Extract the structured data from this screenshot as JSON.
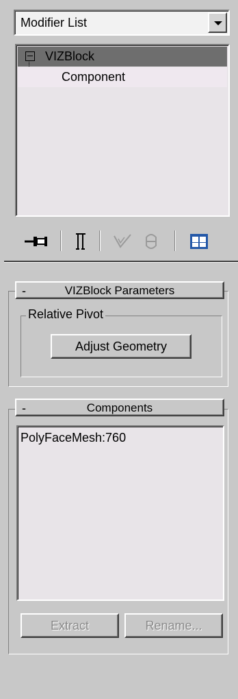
{
  "modifier_dropdown": {
    "value": "Modifier List"
  },
  "stack": {
    "items": [
      {
        "label": "VIZBlock",
        "selected": true,
        "expander": "minus"
      },
      {
        "label": "Component",
        "selected": false
      }
    ]
  },
  "toolbar": {
    "icons": [
      "pin-stack-icon",
      "show-end-result-icon",
      "make-unique-icon",
      "remove-modifier-icon",
      "configure-modifier-sets-icon"
    ]
  },
  "vizblock_params": {
    "collapse_glyph": "-",
    "title": "VIZBlock Parameters",
    "group_label": "Relative Pivot",
    "adjust_button": "Adjust Geometry"
  },
  "components": {
    "collapse_glyph": "-",
    "title": "Components",
    "items": [
      "PolyFaceMesh:760"
    ],
    "extract_button": "Extract",
    "rename_button": "Rename..."
  }
}
